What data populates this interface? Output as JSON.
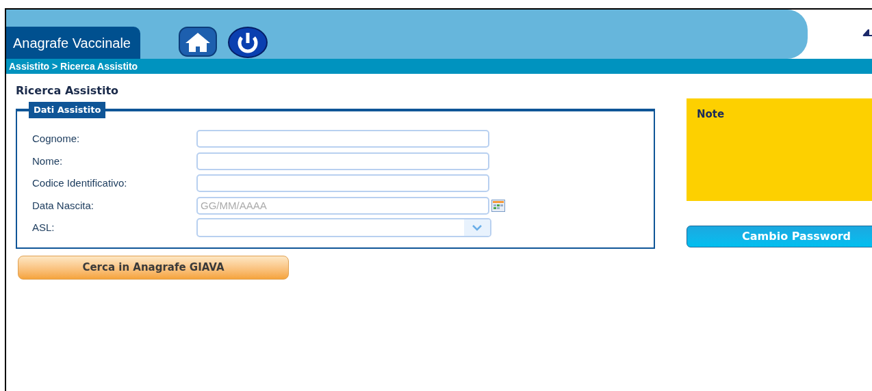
{
  "header": {
    "app_title": "Anagrafe Vaccinale"
  },
  "breadcrumb": "Assistito > Ricerca Assistito",
  "page_title": "Ricerca Assistito",
  "fieldset": {
    "legend": "Dati Assistito",
    "fields": [
      {
        "kind": "text",
        "label": "Cognome:"
      },
      {
        "kind": "text",
        "label": "Nome:"
      },
      {
        "kind": "text",
        "label": "Codice Identificativo:"
      },
      {
        "kind": "date",
        "label": "Data Nascita:",
        "placeholder": "GG/MM/AAAA"
      },
      {
        "kind": "select",
        "label": "ASL:"
      }
    ]
  },
  "search_button": "Cerca in Anagrafe GIAVA",
  "note": {
    "title": "Note"
  },
  "password_button": "Cambio Password"
}
